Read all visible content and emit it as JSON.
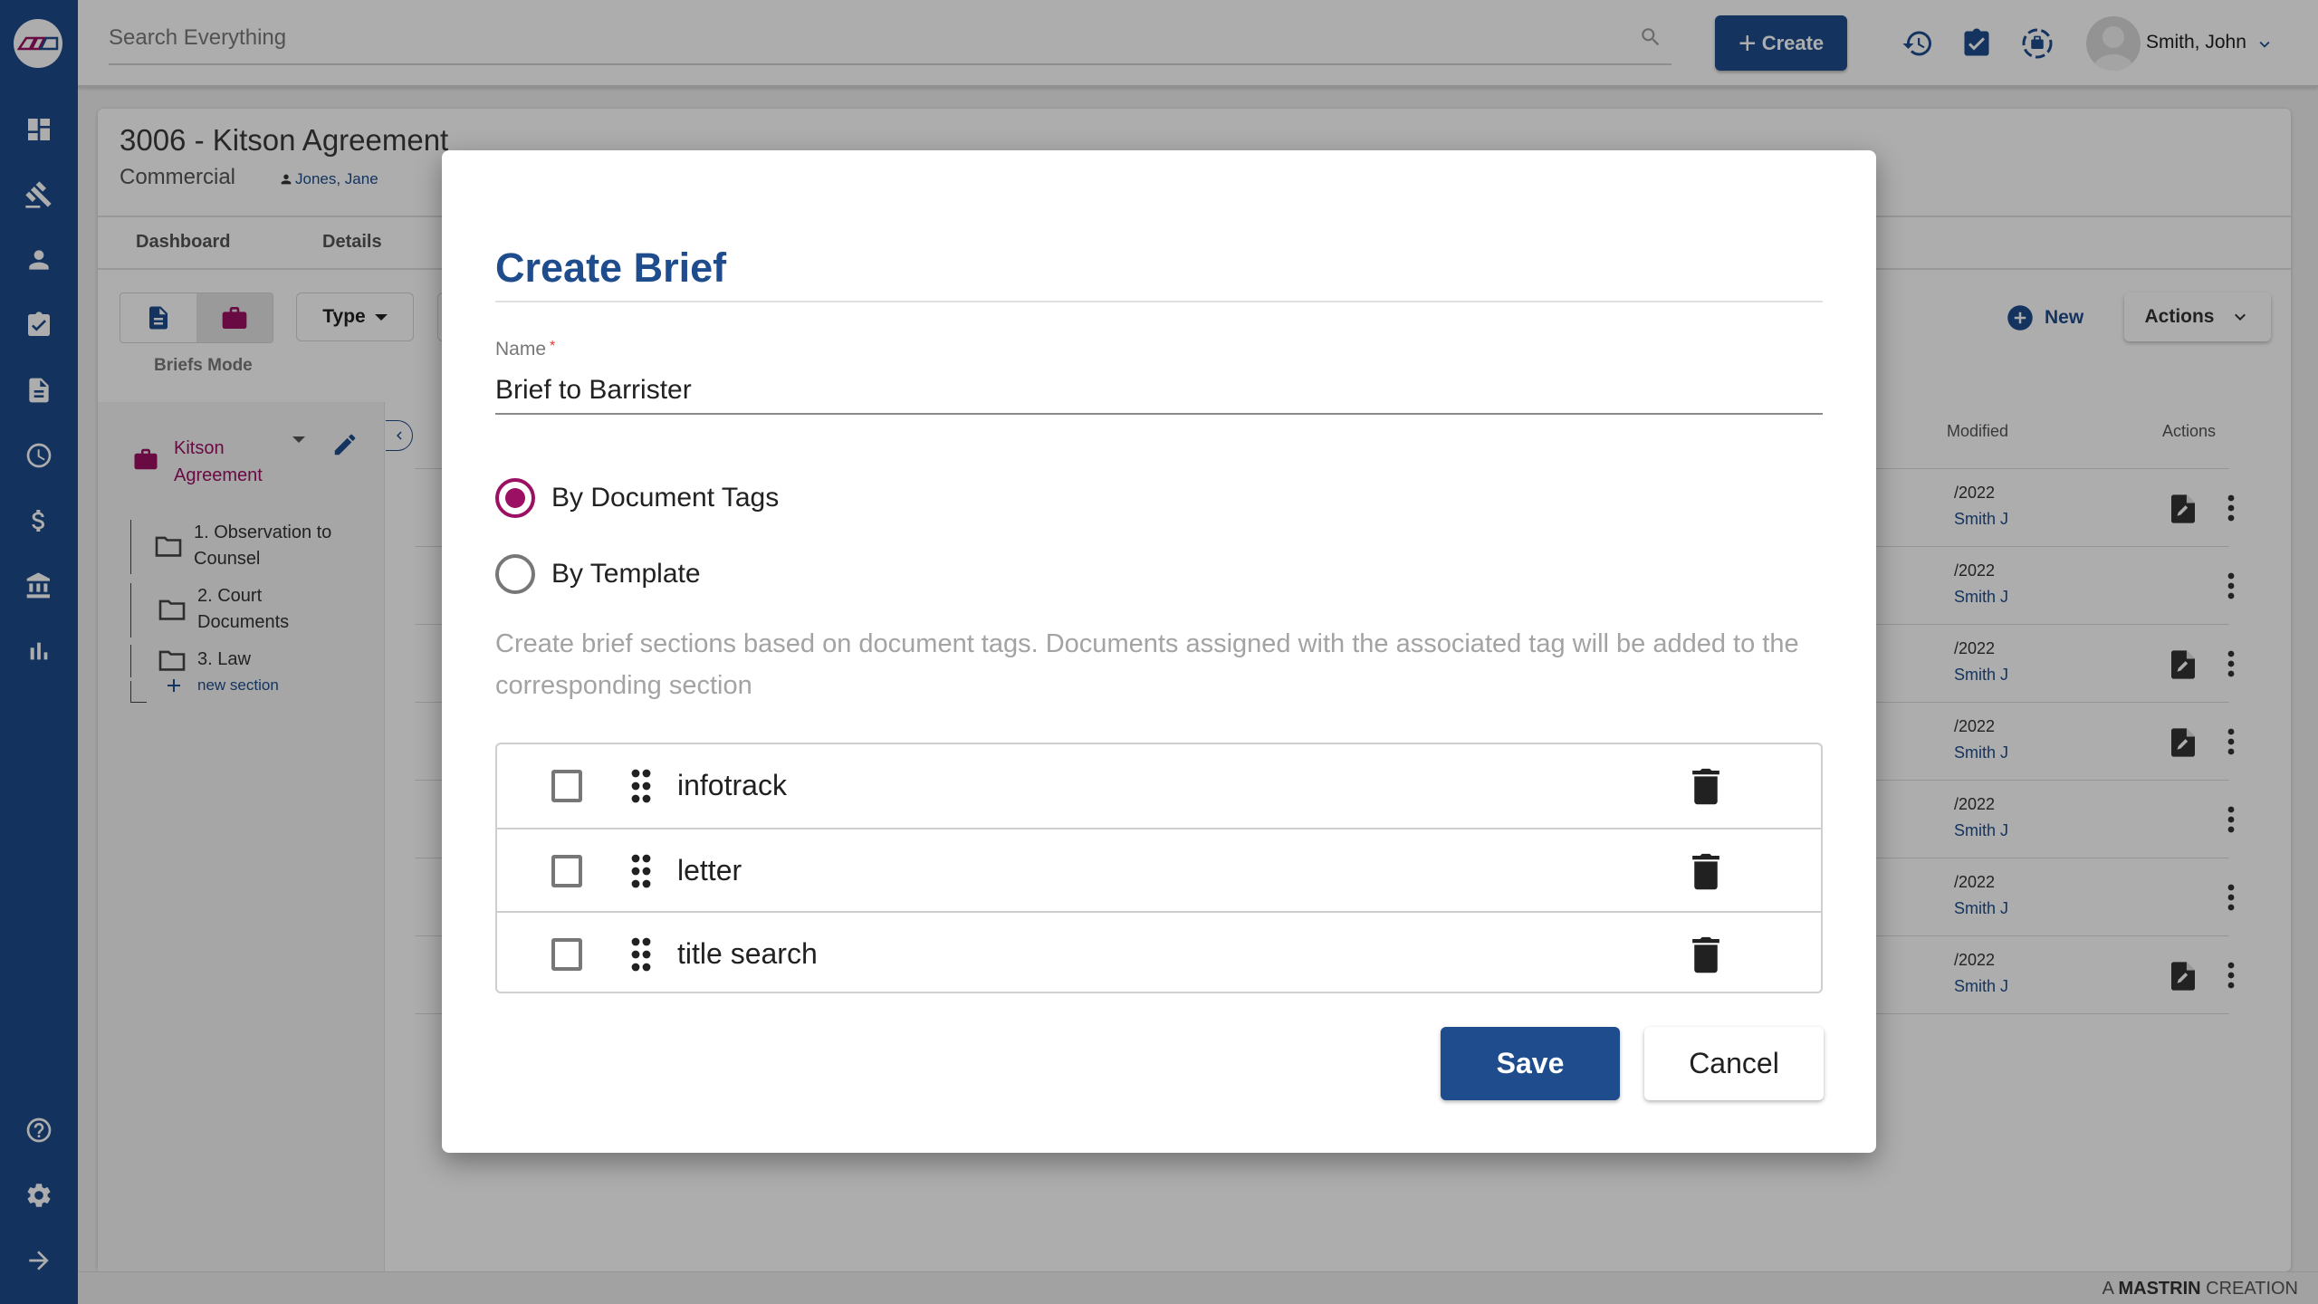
{
  "header": {
    "search_placeholder": "Search Everything",
    "create_label": "Create",
    "user_name": "Smith, John",
    "icons": [
      "history-icon",
      "tasks-icon",
      "brief-capture-icon"
    ]
  },
  "sidebar": {
    "items": [
      {
        "name": "dashboard",
        "icon": "dashboard-icon"
      },
      {
        "name": "matters",
        "icon": "gavel-icon"
      },
      {
        "name": "contacts",
        "icon": "person-icon"
      },
      {
        "name": "tasks",
        "icon": "clipboard-check-icon"
      },
      {
        "name": "documents",
        "icon": "document-icon"
      },
      {
        "name": "time",
        "icon": "clock-icon"
      },
      {
        "name": "billing",
        "icon": "dollar-icon"
      },
      {
        "name": "trust",
        "icon": "bank-icon"
      },
      {
        "name": "reports",
        "icon": "bar-chart-icon"
      }
    ],
    "bottom_items": [
      {
        "name": "help",
        "icon": "help-icon"
      },
      {
        "name": "settings",
        "icon": "gear-icon"
      },
      {
        "name": "expand",
        "icon": "arrow-right-icon"
      }
    ]
  },
  "matter": {
    "title": "3006 - Kitson Agreement",
    "type": "Commercial",
    "owner": "Jones, Jane",
    "tabs": [
      "Dashboard",
      "Details"
    ],
    "mode_label": "Briefs Mode",
    "type_filter": "Type",
    "new_label": "New",
    "actions_label": "Actions",
    "brief_tree": {
      "root": "Kitson Agreement",
      "sections": [
        "1. Observation to Counsel",
        "2. Court Documents",
        "3. Law"
      ],
      "new_section_label": "new section"
    },
    "table": {
      "headers": {
        "modified": "Modified",
        "actions": "Actions"
      },
      "rows": [
        {
          "date": "/2022",
          "by": "Smith J",
          "has_file_edit": true
        },
        {
          "date": "/2022",
          "by": "Smith J",
          "has_file_edit": false
        },
        {
          "date": "/2022",
          "by": "Smith J",
          "has_file_edit": true
        },
        {
          "date": "/2022",
          "by": "Smith J",
          "has_file_edit": true
        },
        {
          "date": "/2022",
          "by": "Smith J",
          "has_file_edit": false
        },
        {
          "date": "/2022",
          "by": "Smith J",
          "has_file_edit": false
        },
        {
          "date": "/2022",
          "by": "Smith J",
          "has_file_edit": true
        }
      ]
    }
  },
  "footer": {
    "prefix": "A",
    "brand": "MASTRIN",
    "suffix": "CREATION"
  },
  "dialog": {
    "title": "Create Brief",
    "name_label": "Name",
    "required_mark": "*",
    "name_value": "Brief to Barrister",
    "options": [
      {
        "label": "By Document Tags",
        "selected": true
      },
      {
        "label": "By Template",
        "selected": false
      }
    ],
    "description": "Create brief sections based on document tags. Documents assigned with the associated tag will be added to the corresponding section",
    "tags": [
      {
        "label": "infotrack",
        "checked": false
      },
      {
        "label": "letter",
        "checked": false
      },
      {
        "label": "title search",
        "checked": false
      }
    ],
    "save_label": "Save",
    "cancel_label": "Cancel"
  },
  "colors": {
    "primary": "#1e4c8c",
    "accent": "#9b1063",
    "required": "#e53935"
  }
}
